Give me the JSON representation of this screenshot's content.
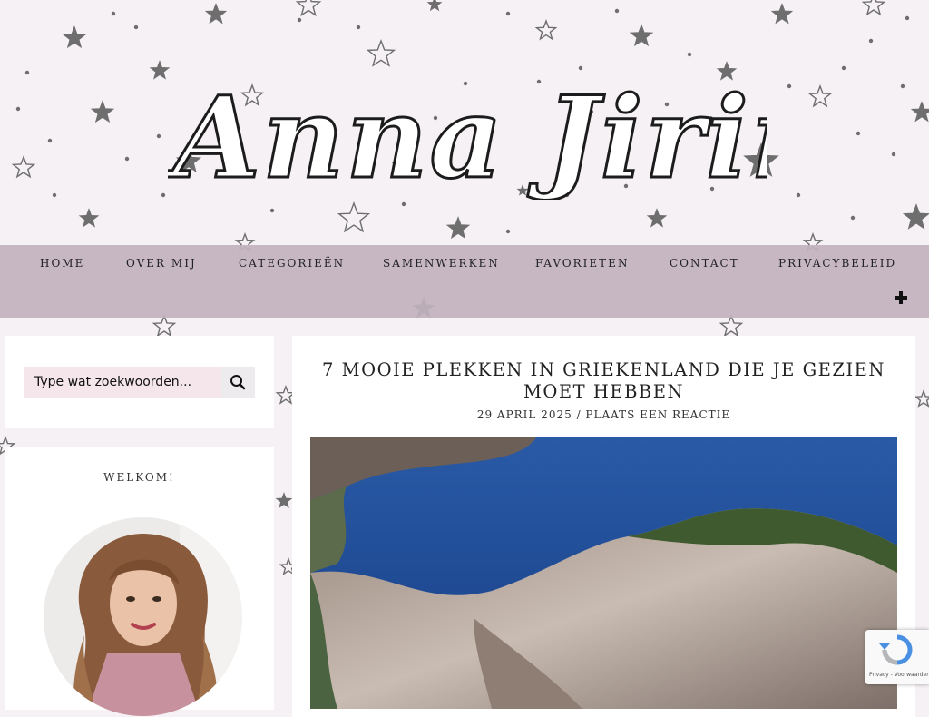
{
  "site": {
    "logo_text": "Anna Jirina"
  },
  "nav": {
    "items": [
      {
        "label": "HOME"
      },
      {
        "label": "OVER MIJ"
      },
      {
        "label": "CATEGORIEËN"
      },
      {
        "label": "SAMENWERKEN"
      },
      {
        "label": "FAVORIETEN"
      },
      {
        "label": "CONTACT"
      },
      {
        "label": "PRIVACYBELEID"
      }
    ],
    "more_icon": "plus-icon"
  },
  "sidebar": {
    "search": {
      "placeholder": "Type wat zoekwoorden...",
      "button_icon": "search-icon"
    },
    "welcome": {
      "title": "WELKOM!"
    }
  },
  "post": {
    "title": "7 MOOIE PLEKKEN IN GRIEKENLAND DIE JE GEZIEN MOET HEBBEN",
    "date": "29 APRIL 2025",
    "separator": "/",
    "comment_link": "PLAATS EEN REACTIE"
  },
  "recaptcha": {
    "text": "Privacy - Voorwaarden"
  },
  "colors": {
    "background": "#f5f1f5",
    "nav_bar": "#c1b2be",
    "search_field": "#f4e6ea",
    "star": "#6e6e6e"
  }
}
